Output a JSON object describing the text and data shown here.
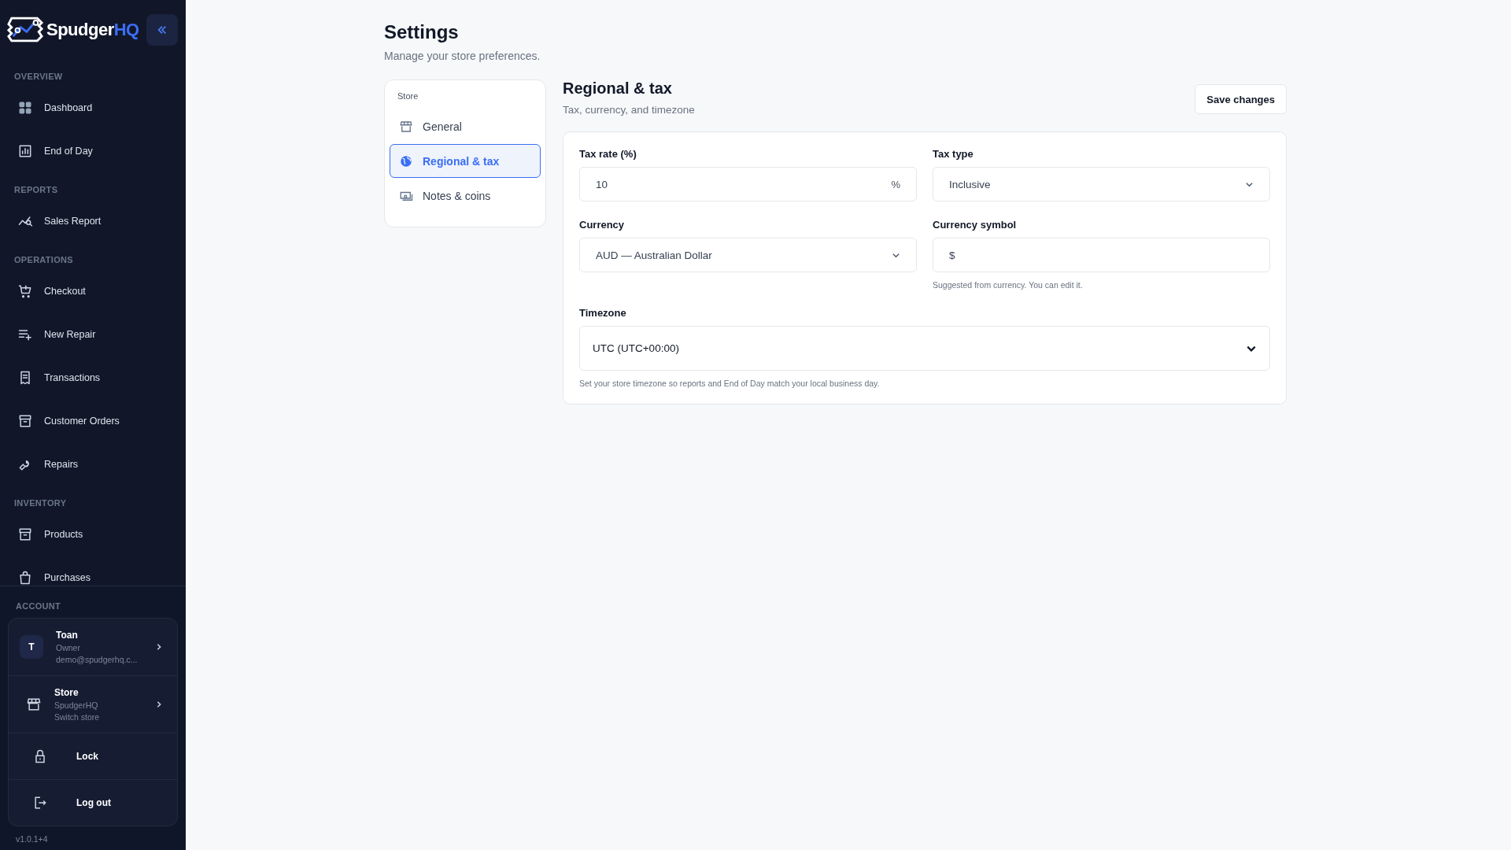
{
  "sidebar": {
    "brand": {
      "name": "Spudger",
      "accent": "HQ"
    },
    "sections": [
      {
        "label": "OVERVIEW",
        "items": [
          {
            "label": "Dashboard"
          },
          {
            "label": "End of Day"
          }
        ]
      },
      {
        "label": "REPORTS",
        "items": [
          {
            "label": "Sales Report"
          }
        ]
      },
      {
        "label": "OPERATIONS",
        "items": [
          {
            "label": "Checkout"
          },
          {
            "label": "New Repair"
          },
          {
            "label": "Transactions"
          },
          {
            "label": "Customer Orders"
          },
          {
            "label": "Repairs"
          }
        ]
      },
      {
        "label": "INVENTORY",
        "items": [
          {
            "label": "Products"
          },
          {
            "label": "Purchases"
          }
        ]
      }
    ],
    "account": {
      "label": "ACCOUNT",
      "user": {
        "initial": "T",
        "name": "Toan",
        "role": "Owner",
        "email": "demo@spudgerhq.c..."
      },
      "store": {
        "name": "Store",
        "line1": "SpudgerHQ",
        "line2": "Switch store"
      },
      "actions": [
        {
          "label": "Lock"
        },
        {
          "label": "Log out"
        }
      ]
    },
    "version": "v1.0.1+4"
  },
  "page": {
    "title": "Settings",
    "subtitle": "Manage your store preferences."
  },
  "settings_nav": {
    "group": "Store",
    "items": [
      {
        "label": "General",
        "selected": false
      },
      {
        "label": "Regional & tax",
        "selected": true
      },
      {
        "label": "Notes & coins",
        "selected": false
      }
    ]
  },
  "panel": {
    "title": "Regional & tax",
    "subtitle": "Tax, currency, and timezone",
    "save_button": "Save changes",
    "fields": [
      {
        "kind": "input",
        "label": "Tax rate (%)",
        "value": "10",
        "suffix": "%"
      },
      {
        "kind": "select",
        "label": "Tax type",
        "value": "Inclusive"
      },
      {
        "kind": "select",
        "label": "Currency",
        "value": "AUD — Australian Dollar"
      },
      {
        "kind": "input",
        "label": "Currency symbol",
        "value": "$",
        "help": "Suggested from currency. You can edit it."
      },
      {
        "kind": "select",
        "label": "Timezone",
        "value": "UTC (UTC+00:00)",
        "wide": true,
        "help": "Set your store timezone so reports and End of Day match your local business day."
      }
    ]
  }
}
